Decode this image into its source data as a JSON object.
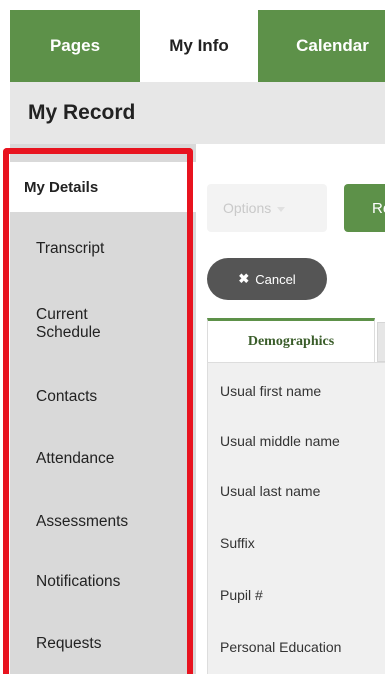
{
  "nav": {
    "tabs": [
      "Pages",
      "My Info",
      "Calendar"
    ]
  },
  "record": {
    "title": "My Record"
  },
  "sidebar": {
    "items": [
      {
        "label": "My Details",
        "active": true
      },
      {
        "label": "Transcript"
      },
      {
        "label": "Current\nSchedule"
      },
      {
        "label": "Contacts"
      },
      {
        "label": "Attendance"
      },
      {
        "label": "Assessments"
      },
      {
        "label": "Notifications"
      },
      {
        "label": "Requests"
      }
    ]
  },
  "toolbar": {
    "options_label": "Options",
    "re_label": "Re",
    "cancel_label": "Cancel",
    "cancel_icon": "✖"
  },
  "detail_tabs": {
    "demographics": "Demographics"
  },
  "fields": [
    "Usual first name",
    "Usual middle name",
    "Usual last name",
    "Suffix",
    "Pupil #",
    "Personal Education"
  ],
  "colors": {
    "accent_green": "#5d9149",
    "highlight_red": "#e8131f",
    "sidebar_bg": "#d9d9d9"
  }
}
